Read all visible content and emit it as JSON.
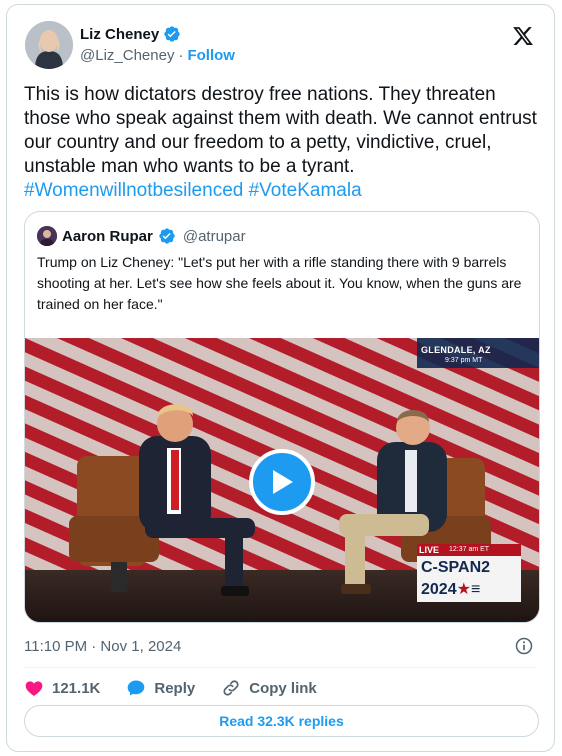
{
  "author": {
    "name": "Liz Cheney",
    "handle": "@Liz_Cheney",
    "separator": "·",
    "follow_label": "Follow"
  },
  "tweet": {
    "text": "This is how dictators destroy free nations. They threaten those who speak against them with death. We cannot entrust our country and our freedom to a petty, vindictive, cruel, unstable man who wants to be a tyrant.",
    "hashtags": [
      "#Womenwillnotbesilenced",
      "#VoteKamala"
    ]
  },
  "quote": {
    "name": "Aaron Rupar",
    "handle": "@atrupar",
    "text": "Trump on Liz Cheney: \"Let's put her with a rifle standing there with 9 barrels shooting at her. Let's see how she feels about it. You know, when the guns are trained on her face.\"",
    "video": {
      "location": "GLENDALE, AZ",
      "time": "9:37 pm MT",
      "live_label": "LIVE",
      "live_time": "12:37 am ET",
      "network": "C-SPAN2",
      "year": "2024"
    }
  },
  "meta": {
    "timestamp": "11:10 PM · Nov 1, 2024"
  },
  "actions": {
    "likes": "121.1K",
    "reply_label": "Reply",
    "copy_label": "Copy link"
  },
  "read_replies_label": "Read 32.3K replies",
  "colors": {
    "accent": "#1d9bf0",
    "like": "#f91880",
    "text": "#0f1419",
    "muted": "#536471"
  }
}
